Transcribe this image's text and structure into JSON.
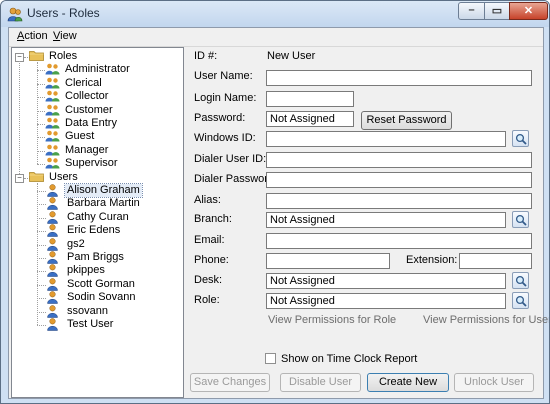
{
  "window": {
    "title": "Users - Roles"
  },
  "titlebar_buttons": {
    "minimize": "–",
    "maximize": "▭",
    "close": "✕"
  },
  "menu": {
    "action_accel": "A",
    "action_rest": "ction",
    "view_accel": "V",
    "view_rest": "iew"
  },
  "tree": {
    "expander_glyph": "−",
    "roles_label": "Roles",
    "roles": [
      "Administrator",
      "Clerical",
      "Collector",
      "Customer",
      "Data Entry",
      "Guest",
      "Manager",
      "Supervisor"
    ],
    "users_label": "Users",
    "users": [
      "Alison Graham",
      "Barbara Martin",
      "Cathy Curan",
      "Eric Edens",
      "gs2",
      "Pam Briggs",
      "pkippes",
      "Scott Gorman",
      "Sodin Sovann",
      "ssovann",
      "Test User"
    ],
    "selected_user": "Alison Graham"
  },
  "form": {
    "id_label": "ID #:",
    "id_value": "New User",
    "user_name_label": "User Name:",
    "user_name_value": "",
    "login_name_label": "Login Name:",
    "login_name_value": "",
    "password_label": "Password:",
    "password_value": "Not Assigned",
    "reset_password_label": "Reset Password",
    "windows_id_label": "Windows ID:",
    "windows_id_value": "",
    "dialer_user_id_label": "Dialer User ID:",
    "dialer_user_id_value": "",
    "dialer_password_label": "Dialer Password:",
    "dialer_password_value": "",
    "alias_label": "Alias:",
    "alias_value": "",
    "branch_label": "Branch:",
    "branch_value": "Not Assigned",
    "email_label": "Email:",
    "email_value": "",
    "phone_label": "Phone:",
    "phone_value": "",
    "extension_label": "Extension:",
    "extension_value": "",
    "desk_label": "Desk:",
    "desk_value": "Not Assigned",
    "role_label": "Role:",
    "role_value": "Not Assigned",
    "view_perm_role": "View Permissions for Role",
    "view_perm_user": "View Permissions for User",
    "time_clock_label": "Show on Time Clock Report",
    "time_clock_checked": false
  },
  "buttons": {
    "save_changes": "Save Changes",
    "disable_user": "Disable User",
    "create_new": "Create New",
    "unlock_user": "Unlock User"
  },
  "icons": {
    "app": "users-app-icon",
    "folder": "folder-icon",
    "role": "role-group-icon",
    "user": "user-icon",
    "lookup": "magnifier-icon"
  },
  "colors": {
    "titlebar": "#c2d6ee",
    "client_bg": "#f0f0f0",
    "close_button": "#c7432a",
    "folder": "#e8c15a",
    "user_icon": "#e29a2e"
  }
}
